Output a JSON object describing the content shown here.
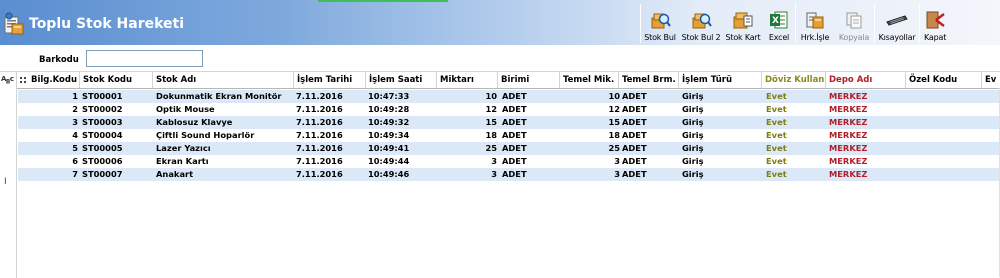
{
  "window": {
    "title": "Toplu Stok Hareketi"
  },
  "toolbar": {
    "buttons": [
      {
        "label": "Stok Bul",
        "icon": "stock-find-icon"
      },
      {
        "label": "Stok Bul 2",
        "icon": "stock-find-2-icon"
      },
      {
        "label": "Stok Kart",
        "icon": "stock-card-icon"
      },
      {
        "label": "Excel",
        "icon": "excel-icon"
      },
      {
        "label": "Hrk.İşle",
        "icon": "process-movement-icon"
      },
      {
        "label": "Kopyala",
        "icon": "copy-icon",
        "disabled": true
      },
      {
        "label": "Kısayollar",
        "icon": "keyboard-icon"
      },
      {
        "label": "Kapat",
        "icon": "close-icon"
      }
    ]
  },
  "barcode": {
    "label": "Barkodu",
    "value": ""
  },
  "grid": {
    "columns": [
      "Bilg.Kodu",
      "Stok Kodu",
      "Stok Adı",
      "İşlem Tarihi",
      "İşlem Saati",
      "Miktarı",
      "Birimi",
      "Temel Mik.",
      "Temel Brm.",
      "İşlem Türü",
      "Döviz Kullan",
      "Depo Adı",
      "Özel Kodu",
      "Ev"
    ],
    "rows": [
      [
        "1",
        "ST00001",
        "Dokunmatik Ekran Monitör",
        "7.11.2016",
        "10:47:33",
        "10",
        "ADET",
        "10",
        "ADET",
        "Giriş",
        "Evet",
        "MERKEZ",
        ""
      ],
      [
        "2",
        "ST00002",
        "Optik Mouse",
        "7.11.2016",
        "10:49:28",
        "12",
        "ADET",
        "12",
        "ADET",
        "Giriş",
        "Evet",
        "MERKEZ",
        ""
      ],
      [
        "3",
        "ST00003",
        "Kablosuz Klavye",
        "7.11.2016",
        "10:49:32",
        "15",
        "ADET",
        "15",
        "ADET",
        "Giriş",
        "Evet",
        "MERKEZ",
        ""
      ],
      [
        "4",
        "ST00004",
        "Çiftli Sound Hoparlör",
        "7.11.2016",
        "10:49:34",
        "18",
        "ADET",
        "18",
        "ADET",
        "Giriş",
        "Evet",
        "MERKEZ",
        ""
      ],
      [
        "5",
        "ST00005",
        "Lazer Yazıcı",
        "7.11.2016",
        "10:49:41",
        "25",
        "ADET",
        "25",
        "ADET",
        "Giriş",
        "Evet",
        "MERKEZ",
        ""
      ],
      [
        "6",
        "ST00006",
        "Ekran Kartı",
        "7.11.2016",
        "10:49:44",
        "3",
        "ADET",
        "3",
        "ADET",
        "Giriş",
        "Evet",
        "MERKEZ",
        ""
      ],
      [
        "7",
        "ST00007",
        "Anakart",
        "7.11.2016",
        "10:49:46",
        "3",
        "ADET",
        "3",
        "ADET",
        "Giriş",
        "Evet",
        "MERKEZ",
        ""
      ]
    ]
  },
  "colors": {
    "title_bar": "#5a8ed0",
    "row_alt": "#dbe8f7",
    "doviz": "#7d7d12",
    "depo": "#b0202a"
  }
}
